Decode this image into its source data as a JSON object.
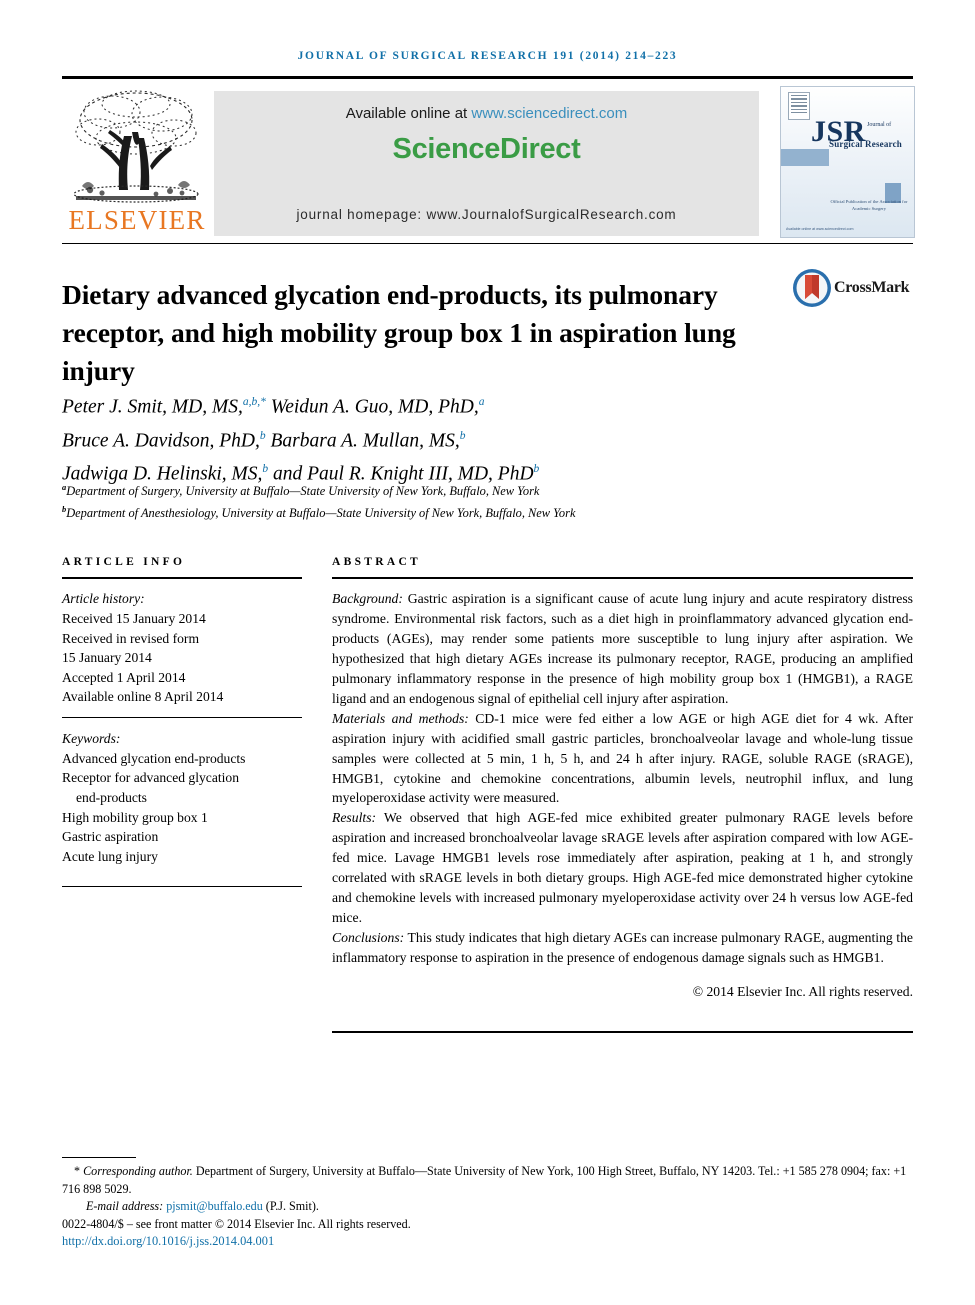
{
  "running_head": "JOURNAL OF SURGICAL RESEARCH 191 (2014) 214–223",
  "masthead": {
    "publisher_wordmark": "ELSEVIER",
    "available_prefix": "Available online at ",
    "available_url": "www.sciencedirect.com",
    "sciencedirect_logo": "ScienceDirect",
    "journal_homepage": "journal homepage: www.JournalofSurgicalResearch.com",
    "cover": {
      "acronym": "JSR",
      "sub_small": "Journal of",
      "sub_main": "Surgical Research",
      "note": "Official Publication of the Association for Academic Surgery",
      "foot": "Available online at www.sciencedirect.com"
    }
  },
  "article": {
    "title": "Dietary advanced glycation end-products, its pulmonary receptor, and high mobility group box 1 in aspiration lung injury",
    "crossmark_label": "CrossMark",
    "authors_lines": [
      "Peter J. Smit, MD, MS,",
      "Bruce A. Davidson, PhD,",
      "Jadwiga D. Helinski, MS,"
    ],
    "authors_full": "Peter J. Smit, MD, MS,a,b,* Weidun A. Guo, MD, PhD,a Bruce A. Davidson, PhD,b Barbara A. Mullan, MS,b Jadwiga D. Helinski, MS,b and Paul R. Knight III, MD, PhDb",
    "author_parts": {
      "l1a": "Peter J. Smit, MD, MS,",
      "l1sup": "a,b,*",
      "l1b": " Weidun A. Guo, MD, PhD,",
      "l1sup2": "a",
      "l2a": "Bruce A. Davidson, PhD,",
      "l2sup": "b",
      "l2b": " Barbara A. Mullan, MS,",
      "l2sup2": "b",
      "l3a": "Jadwiga D. Helinski, MS,",
      "l3sup": "b",
      "l3b": " and Paul R. Knight III, MD, PhD",
      "l3sup2": "b"
    },
    "affiliations": [
      {
        "marker": "a",
        "text": "Department of Surgery, University at Buffalo—State University of New York, Buffalo, New York"
      },
      {
        "marker": "b",
        "text": "Department of Anesthesiology, University at Buffalo—State University of New York, Buffalo, New York"
      }
    ]
  },
  "article_info": {
    "heading": "ARTICLE INFO",
    "history_label": "Article history:",
    "history": [
      "Received 15 January 2014",
      "Received in revised form",
      "15 January 2014",
      "Accepted 1 April 2014",
      "Available online 8 April 2014"
    ],
    "keywords_label": "Keywords:",
    "keywords": [
      "Advanced glycation end-products",
      "Receptor for advanced glycation",
      "end-products",
      "High mobility group box 1",
      "Gastric aspiration",
      "Acute lung injury"
    ]
  },
  "abstract": {
    "heading": "ABSTRACT",
    "sections": [
      {
        "label": "Background:",
        "text": " Gastric aspiration is a significant cause of acute lung injury and acute respiratory distress syndrome. Environmental risk factors, such as a diet high in proinflammatory advanced glycation end-products (AGEs), may render some patients more susceptible to lung injury after aspiration. We hypothesized that high dietary AGEs increase its pulmonary receptor, RAGE, producing an amplified pulmonary inflammatory response in the presence of high mobility group box 1 (HMGB1), a RAGE ligand and an endogenous signal of epithelial cell injury after aspiration."
      },
      {
        "label": "Materials and methods:",
        "text": " CD-1 mice were fed either a low AGE or high AGE diet for 4 wk. After aspiration injury with acidified small gastric particles, bronchoalveolar lavage and whole-lung tissue samples were collected at 5 min, 1 h, 5 h, and 24 h after injury. RAGE, soluble RAGE (sRAGE), HMGB1, cytokine and chemokine concentrations, albumin levels, neutrophil influx, and lung myeloperoxidase activity were measured."
      },
      {
        "label": "Results:",
        "text": " We observed that high AGE-fed mice exhibited greater pulmonary RAGE levels before aspiration and increased bronchoalveolar lavage sRAGE levels after aspiration compared with low AGE-fed mice. Lavage HMGB1 levels rose immediately after aspiration, peaking at 1 h, and strongly correlated with sRAGE levels in both dietary groups. High AGE-fed mice demonstrated higher cytokine and chemokine levels with increased pulmonary myeloperoxidase activity over 24 h versus low AGE-fed mice."
      },
      {
        "label": "Conclusions:",
        "text": " This study indicates that high dietary AGEs can increase pulmonary RAGE, augmenting the inflammatory response to aspiration in the presence of endogenous damage signals such as HMGB1."
      }
    ],
    "copyright": "© 2014 Elsevier Inc. All rights reserved."
  },
  "footnotes": {
    "corresponding_marker": "*",
    "corresponding_label": "Corresponding author.",
    "corresponding_text": " Department of Surgery, University at Buffalo—State University of New York, 100 High Street, Buffalo, NY 14203. Tel.: +1 585 278 0904; fax: +1 716 898 5029.",
    "email_label": "E-mail address:",
    "email": "pjsmit@buffalo.edu",
    "email_owner": "(P.J. Smit).",
    "front_matter": "0022-4804/$ – see front matter © 2014 Elsevier Inc. All rights reserved.",
    "doi": "http://dx.doi.org/10.1016/j.jss.2014.04.001"
  },
  "colors": {
    "link_blue": "#1170a8",
    "elsevier_orange": "#e87722",
    "sciencedirect_green": "#3a9c45",
    "cover_navy": "#16365e"
  }
}
